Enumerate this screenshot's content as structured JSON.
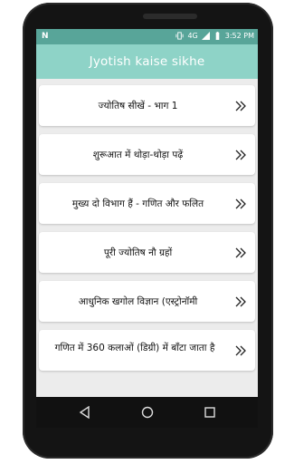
{
  "status": {
    "network": "4G",
    "time": "3:52 PM"
  },
  "app": {
    "title": "Jyotish kaise sikhe"
  },
  "items": [
    {
      "label": "ज्योतिष सीखें - भाग 1"
    },
    {
      "label": "शुरूआत में थोड़ा-थोड़ा पढ़ें"
    },
    {
      "label": "मुख्य दो विभाग हैं - गणित और फलित"
    },
    {
      "label": "पूरी ज्योतिष नौ ग्रहों"
    },
    {
      "label": "आधुनिक खगोल विज्ञान (एस्ट्रोनॉमी"
    },
    {
      "label": "गणित में 360 कलाओं (डिग्री) में बाँटा जाता है"
    }
  ],
  "colors": {
    "statusbar": "#58a599",
    "appbar": "#8ed3c7",
    "background": "#ececec"
  }
}
